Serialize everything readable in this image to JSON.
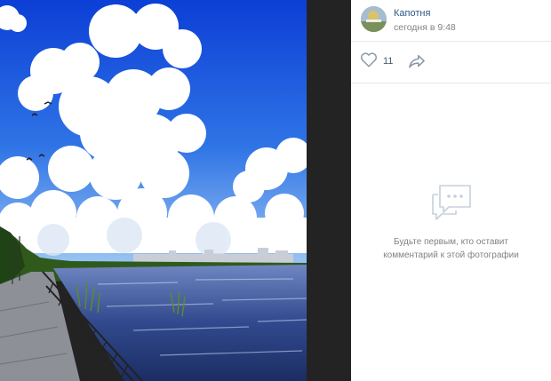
{
  "post": {
    "author": "Капотня",
    "time": "сегодня в 9:48",
    "likes": "11"
  },
  "comments": {
    "empty_text": "Будьте первым, кто оставит\nкомментарий к этой фотографии"
  },
  "icons": {
    "like": "heart-icon",
    "share": "share-arrow-icon",
    "empty": "comments-bubble-icon"
  },
  "colors": {
    "author_link": "#2a5885",
    "muted_text": "#828282",
    "viewer_bg": "#232323"
  }
}
